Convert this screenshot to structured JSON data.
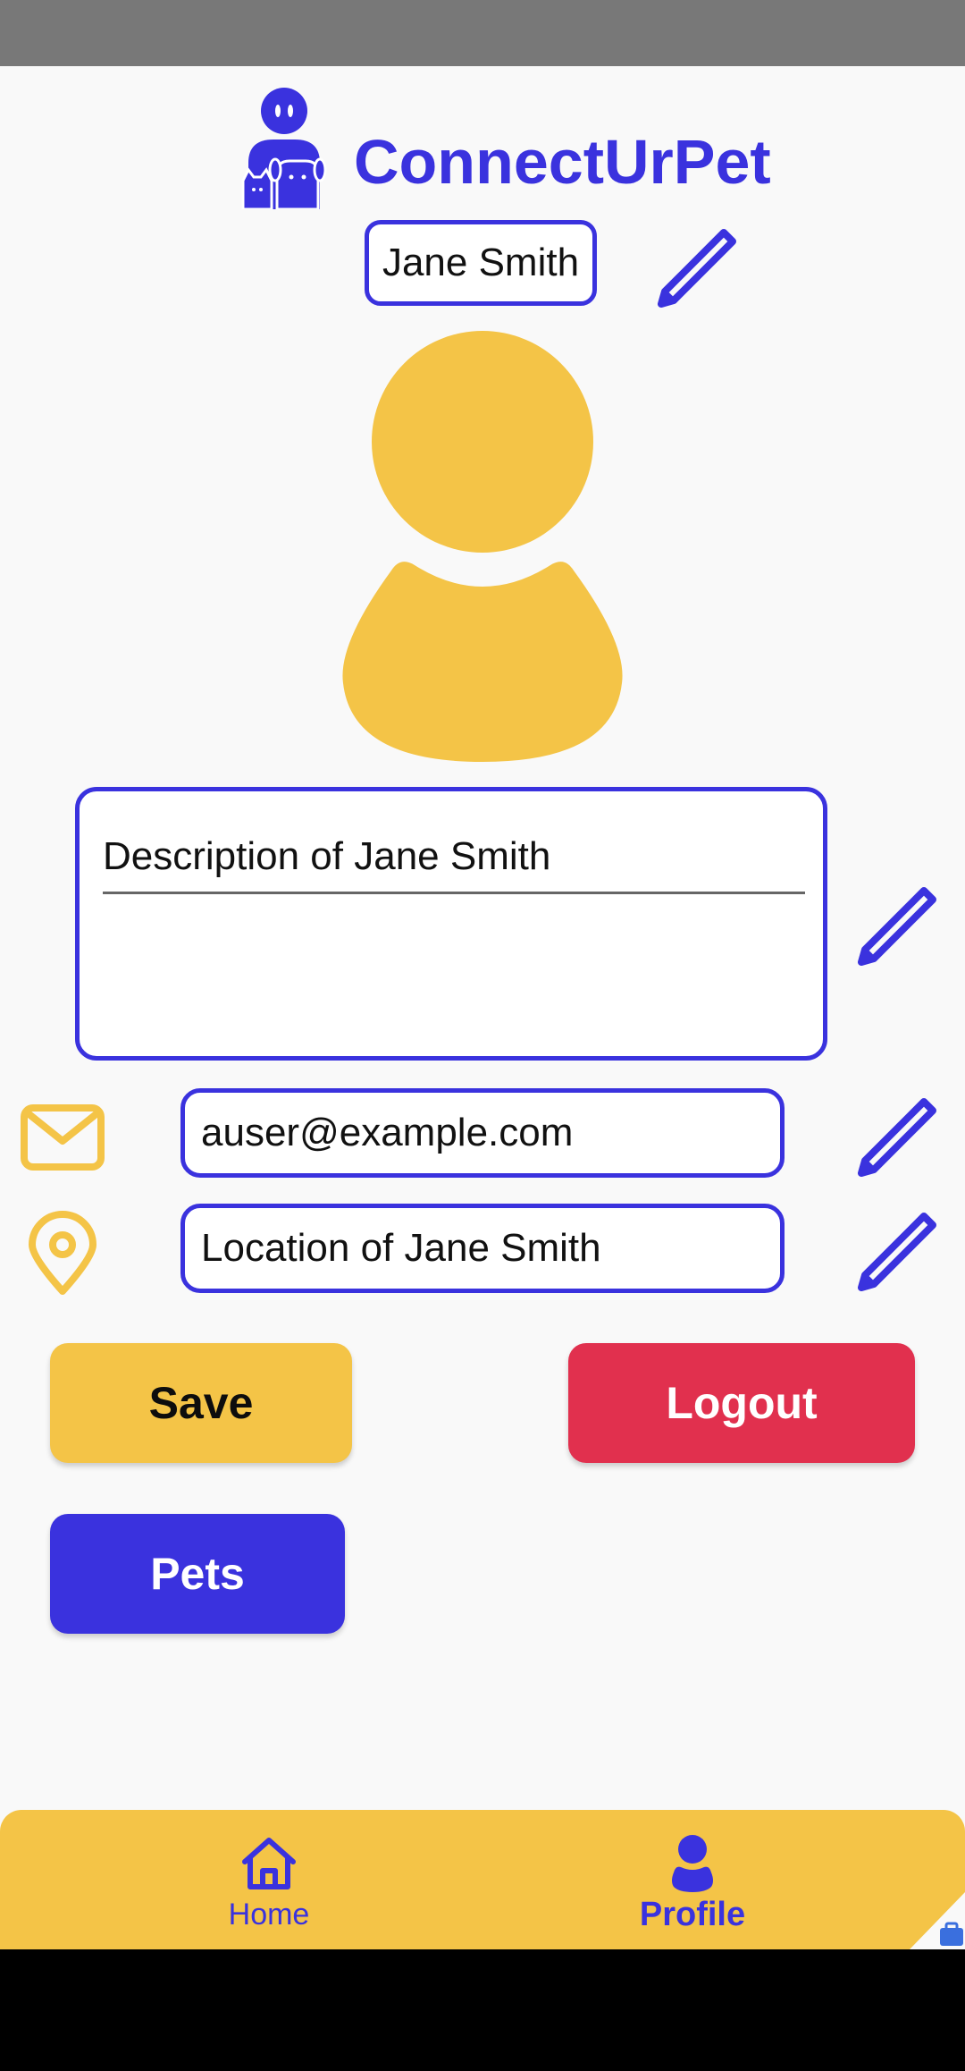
{
  "app": {
    "title": "ConnectUrPet"
  },
  "profile": {
    "name": "Jane Smith",
    "description": "Description of Jane Smith",
    "email": "auser@example.com",
    "location": "Location of Jane Smith"
  },
  "actions": {
    "save_label": "Save",
    "logout_label": "Logout",
    "pets_label": "Pets"
  },
  "bottom_nav": {
    "items": [
      {
        "label": "Home",
        "icon": "home-icon",
        "active": false
      },
      {
        "label": "Profile",
        "icon": "person-icon",
        "active": true
      }
    ]
  },
  "colors": {
    "primary": "#3a32de",
    "accent": "#f4c447",
    "danger": "#e1304e",
    "background": "#f9f9f9"
  }
}
